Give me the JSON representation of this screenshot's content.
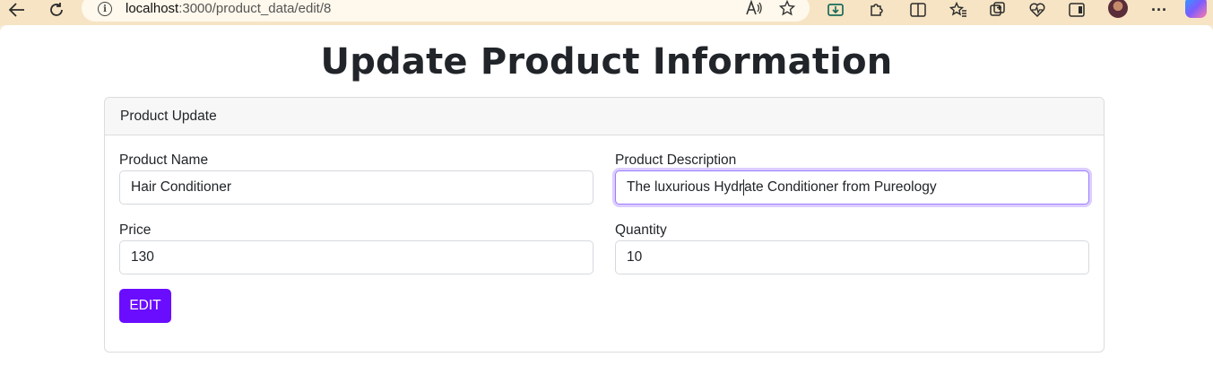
{
  "browser": {
    "url_host": "localhost",
    "url_path": ":3000/product_data/edit/8",
    "icons": [
      "back-arrow-icon",
      "refresh-icon",
      "info-icon",
      "read-aloud-icon",
      "favorite-star-icon",
      "download-icon",
      "extensions-icon",
      "split-screen-icon",
      "favorites-icon",
      "collections-icon",
      "health-icon",
      "sidebar-icon",
      "profile-avatar",
      "more-icon",
      "copilot-icon"
    ]
  },
  "page": {
    "title": "Update Product Information"
  },
  "card": {
    "header": "Product Update",
    "fields": {
      "name": {
        "label": "Product Name",
        "value": "Hair Conditioner"
      },
      "description": {
        "label": "Product Description",
        "value_before_caret": "The luxurious Hydr",
        "value_after_caret": "ate Conditioner from Pureology"
      },
      "price": {
        "label": "Price",
        "value": "130"
      },
      "quantity": {
        "label": "Quantity",
        "value": "10"
      }
    },
    "submit_label": "EDIT"
  },
  "colors": {
    "button_bg": "#6a0dff",
    "focus_ring": "#9c7cff",
    "browser_chrome": "#f6e4c4"
  }
}
